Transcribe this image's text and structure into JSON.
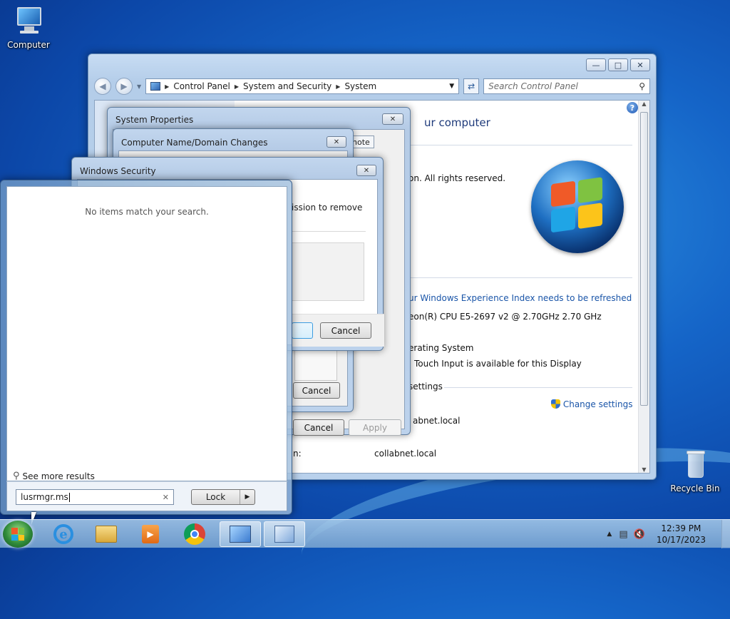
{
  "desktop": {
    "icons": [
      {
        "label": "Computer"
      },
      {
        "label": "Recycle Bin"
      }
    ]
  },
  "control_panel": {
    "breadcrumb": [
      "Control Panel",
      "System and Security",
      "System"
    ],
    "search_placeholder": "Search Control Panel",
    "title_partial": "ur computer",
    "rights_text": "on.  All rights reserved.",
    "wei_link": "ur Windows Experience Index needs to be refreshed",
    "cpu_text": "eon(R) CPU E5-2697 v2 @ 2.70GHz   2.70 GHz",
    "os_text": "erating System",
    "touch_text": "Touch Input is available for this Display",
    "settings_text": "settings",
    "change_settings": "Change settings",
    "domain1": "abnet.local",
    "domain_label_partial": "n:",
    "domain2": "collabnet.local"
  },
  "system_properties": {
    "title": "System Properties",
    "tab_partial": "note",
    "cancel": "Cancel",
    "apply": "Apply"
  },
  "computer_name": {
    "title": "Computer Name/Domain Changes",
    "cancel": "Cancel"
  },
  "windows_security": {
    "title": "Windows Security",
    "text_partial": "ission to remove",
    "cancel": "Cancel"
  },
  "start_menu": {
    "no_results": "No items match your search.",
    "see_more": "See more results",
    "search_value": "lusrmgr.ms",
    "lock": "Lock"
  },
  "taskbar": {
    "time": "12:39 PM",
    "date": "10/17/2023"
  }
}
